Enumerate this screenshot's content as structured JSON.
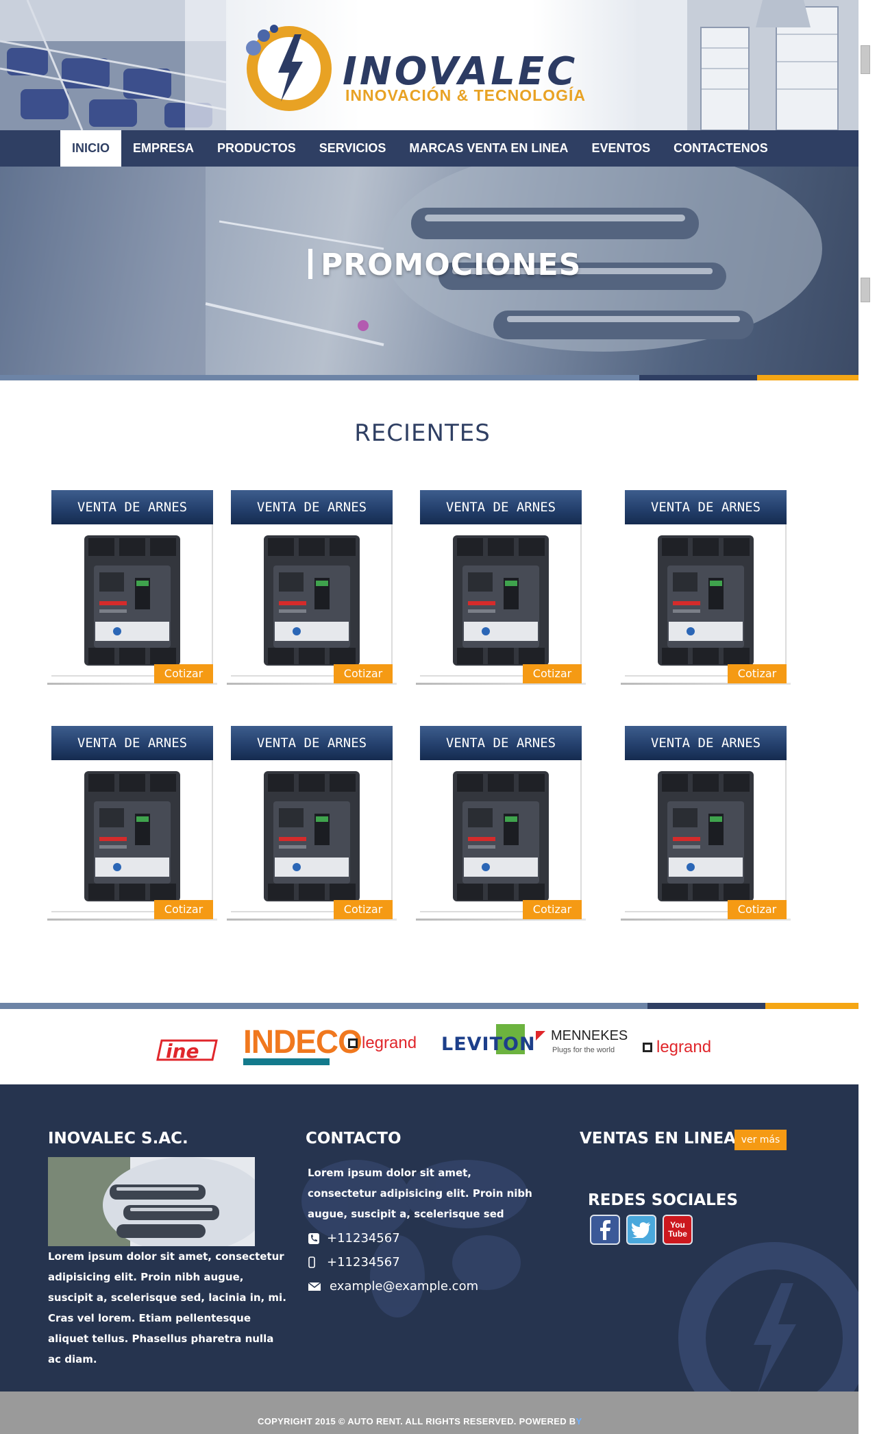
{
  "header": {
    "logo_name": "INOVALEC",
    "logo_tagline": "INNOVACIÓN & TECNOLOGÍA"
  },
  "nav": {
    "items": [
      {
        "label": "INICIO",
        "active": true
      },
      {
        "label": "EMPRESA",
        "active": false
      },
      {
        "label": "PRODUCTOS",
        "active": false
      },
      {
        "label": "SERVICIOS",
        "active": false
      },
      {
        "label": "MARCAS VENTA EN LINEA",
        "active": false
      },
      {
        "label": "EVENTOS",
        "active": false
      },
      {
        "label": "CONTACTENOS",
        "active": false
      }
    ]
  },
  "hero": {
    "title": "PROMOCIONES"
  },
  "recent": {
    "title": "RECIENTES",
    "cards": [
      {
        "title": "VENTA DE ARNES",
        "button": "Cotizar"
      },
      {
        "title": "VENTA DE ARNES",
        "button": "Cotizar"
      },
      {
        "title": "VENTA DE ARNES",
        "button": "Cotizar"
      },
      {
        "title": "VENTA DE ARNES",
        "button": "Cotizar"
      },
      {
        "title": "VENTA DE ARNES",
        "button": "Cotizar"
      },
      {
        "title": "VENTA DE ARNES",
        "button": "Cotizar"
      },
      {
        "title": "VENTA DE ARNES",
        "button": "Cotizar"
      },
      {
        "title": "VENTA DE ARNES",
        "button": "Cotizar"
      }
    ]
  },
  "brands": {
    "items": [
      {
        "name": "ine",
        "label": "ine"
      },
      {
        "name": "indeco",
        "label": "INDECO"
      },
      {
        "name": "legrand",
        "label": "legrand"
      },
      {
        "name": "leviton",
        "label": "LEVITON"
      },
      {
        "name": "mennekes",
        "label": "MENNEKES",
        "sub": "Plugs for the world"
      },
      {
        "name": "legrand",
        "label": "legrand"
      }
    ]
  },
  "footer": {
    "company": {
      "title": "INOVALEC S.AC.",
      "text": "Lorem ipsum dolor sit amet, consectetur adipisicing elit. Proin nibh augue, suscipit a, scelerisque sed, lacinia in, mi. Cras vel lorem. Etiam pellentesque aliquet tellus. Phasellus pharetra nulla ac diam."
    },
    "contact": {
      "title": "CONTACTO",
      "text": "Lorem ipsum dolor sit amet, consectetur adipisicing elit. Proin nibh augue, suscipit a, scelerisque sed",
      "phone": "+11234567",
      "mobile": "+11234567",
      "email": "example@example.com"
    },
    "sales": {
      "title": "VENTAS EN LINEA",
      "button": "ver más"
    },
    "social": {
      "title": "REDES SOCIALES",
      "items": [
        "facebook",
        "twitter",
        "youtube"
      ],
      "youtube_label": "You Tube"
    },
    "copyright_main": "COPYRIGHT 2015 © AUTO RENT. ALL RIGHTS RESERVED.  POWERED B",
    "copyright_tail": "Y"
  },
  "colors": {
    "navy": "#2f3f63",
    "footer_bg": "#26344f",
    "orange": "#f59a14",
    "gold": "#e8a224"
  }
}
